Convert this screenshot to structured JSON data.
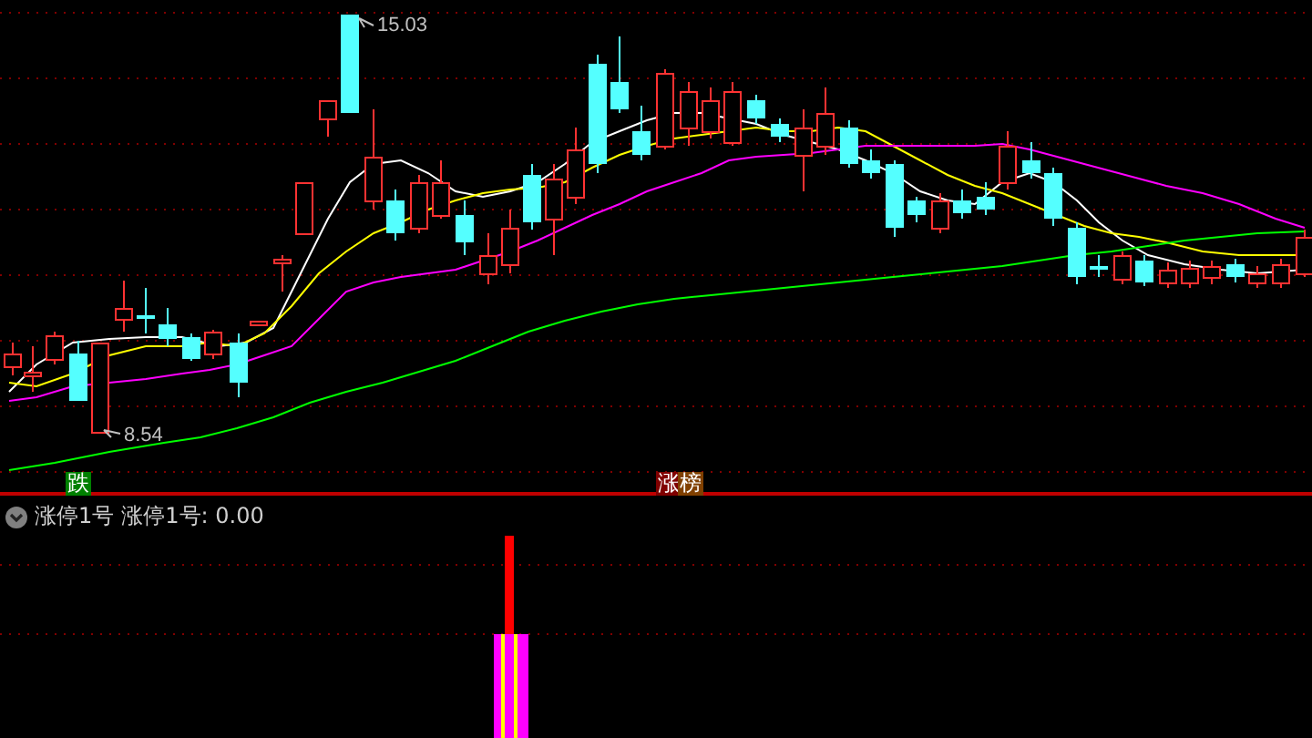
{
  "price_chart": {
    "high_label": "15.03",
    "low_label": "8.54"
  },
  "signal_tags": [
    {
      "text": "跌",
      "kind": "fall"
    },
    {
      "text": "涨",
      "kind": "rise"
    },
    {
      "text": "榜",
      "kind": "board"
    }
  ],
  "indicator": {
    "name": "涨停1号",
    "value_label": "涨停1号: 0.00"
  }
}
